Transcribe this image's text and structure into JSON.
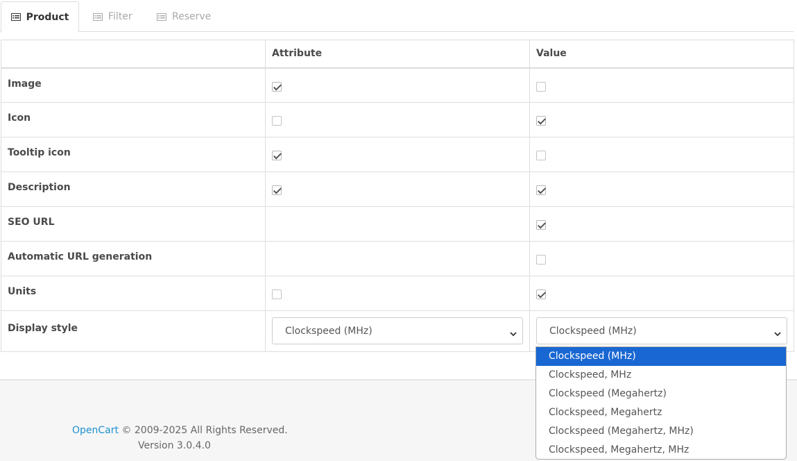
{
  "tabs": [
    {
      "label": "Product",
      "active": true
    },
    {
      "label": "Filter",
      "active": false
    },
    {
      "label": "Reserve",
      "active": false
    }
  ],
  "table": {
    "headers": [
      "",
      "Attribute",
      "Value"
    ],
    "rows": [
      {
        "label": "Image",
        "attribute": true,
        "value": false
      },
      {
        "label": "Icon",
        "attribute": false,
        "value": true
      },
      {
        "label": "Tooltip icon",
        "attribute": true,
        "value": false
      },
      {
        "label": "Description",
        "attribute": true,
        "value": true
      },
      {
        "label": "SEO URL",
        "attribute": null,
        "value": true
      },
      {
        "label": "Automatic URL generation",
        "attribute": null,
        "value": false
      },
      {
        "label": "Units",
        "attribute": false,
        "value": true
      }
    ],
    "display_style": {
      "label": "Display style",
      "attribute_selected": "Clockspeed (MHz)",
      "value_selected": "Clockspeed (MHz)"
    }
  },
  "dropdown": {
    "options": [
      "Clockspeed (MHz)",
      "Clockspeed, MHz",
      "Clockspeed (Megahertz)",
      "Clockspeed, Megahertz",
      "Clockspeed (Megahertz, MHz)",
      "Clockspeed, Megahertz, MHz"
    ],
    "selected_index": 0,
    "highlight_color": "#1967d2"
  },
  "footer": {
    "brand": "OpenCart",
    "copyright": " © 2009-2025 All Rights Reserved.",
    "version": "Version 3.0.4.0",
    "link_color": "#1e91cf"
  }
}
